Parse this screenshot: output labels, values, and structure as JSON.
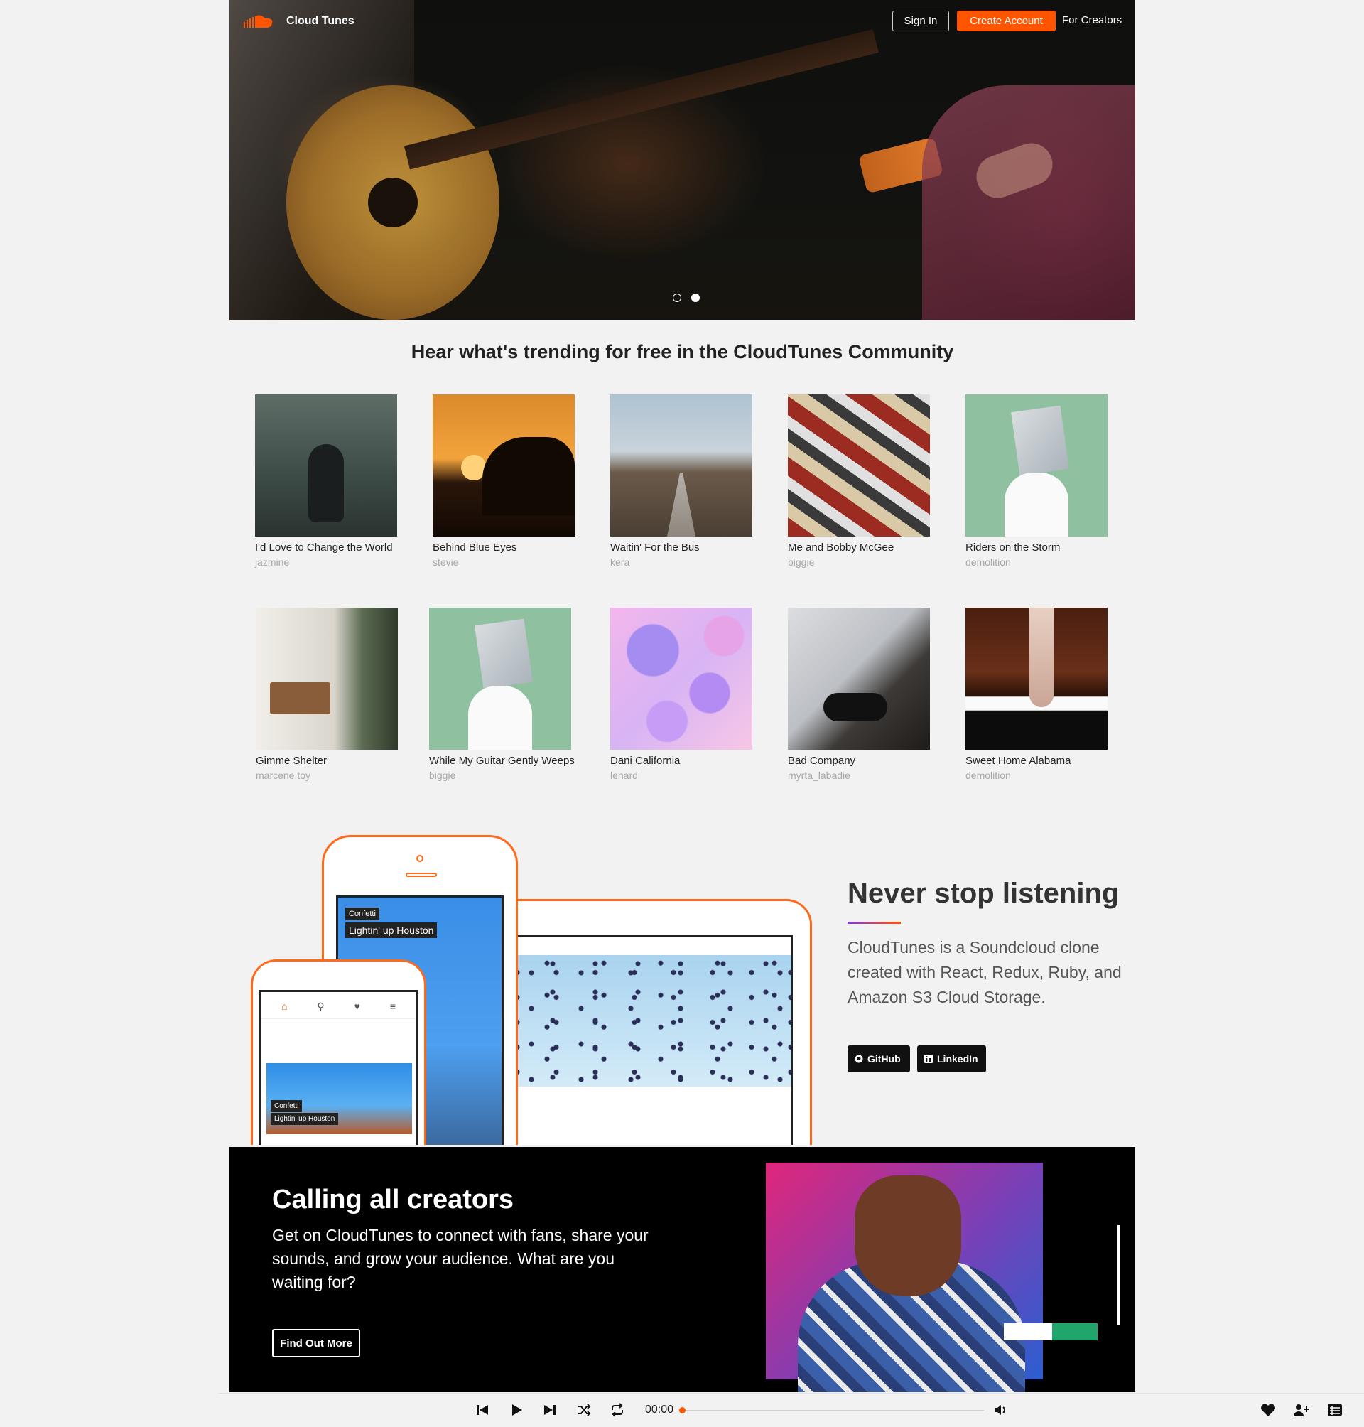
{
  "header": {
    "brand": "Cloud Tunes",
    "sign_in": "Sign In",
    "create_account": "Create Account",
    "for_creators": "For Creators",
    "colors": {
      "accent": "#ff5500"
    },
    "carousel_slides": 2,
    "carousel_active": 2
  },
  "trending": {
    "title": "Hear what's trending for free in the CloudTunes Community",
    "tracks": [
      {
        "title": "I'd Love to Change the World",
        "user": "jazmine"
      },
      {
        "title": "Behind Blue Eyes",
        "user": "stevie"
      },
      {
        "title": "Waitin' For the Bus",
        "user": "kera"
      },
      {
        "title": "Me and Bobby McGee",
        "user": "biggie"
      },
      {
        "title": "Riders on the Storm",
        "user": "demolition"
      },
      {
        "title": "Gimme Shelter",
        "user": "marcene.toy"
      },
      {
        "title": "While My Guitar Gently Weeps",
        "user": "biggie"
      },
      {
        "title": "Dani California",
        "user": "lenard"
      },
      {
        "title": "Bad Company",
        "user": "myrta_labadie"
      },
      {
        "title": "Sweet Home Alabama",
        "user": "demolition"
      }
    ]
  },
  "never_stop": {
    "title": "Never stop listening",
    "description": "CloudTunes is a Soundcloud clone created with React, Redux, Ruby, and Amazon S3 Cloud Storage.",
    "github": "GitHub",
    "linkedin": "LinkedIn",
    "phone_label_1": "Confetti",
    "phone_label_2": "Lightin' up Houston"
  },
  "creators": {
    "title": "Calling all creators",
    "description": "Get on CloudTunes to connect with fans, share your sounds, and grow your audience. What are you waiting for?",
    "button": "Find Out More"
  },
  "player": {
    "time": "00:00",
    "progress": 0,
    "icons": [
      "skip-back-icon",
      "play-icon",
      "skip-forward-icon",
      "shuffle-icon",
      "repeat-icon",
      "volume-icon",
      "heart-icon",
      "follow-icon",
      "queue-icon"
    ]
  }
}
